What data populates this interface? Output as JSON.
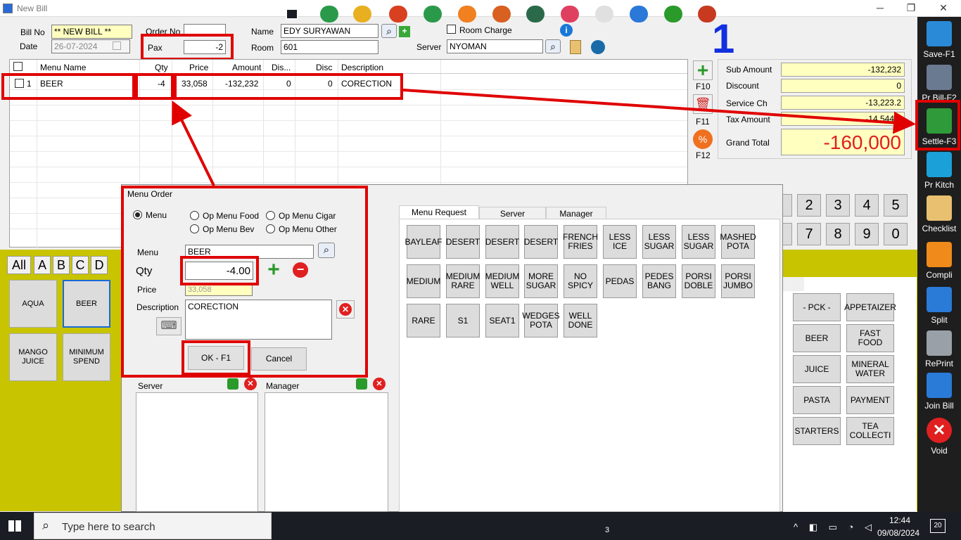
{
  "window": {
    "title": "New Bill",
    "min": "─",
    "restore": "❐",
    "close": "✕"
  },
  "header": {
    "bill_no_label": "Bill No",
    "bill_no": "** NEW BILL **",
    "date_label": "Date",
    "date": "26-07-2024",
    "order_no_label": "Order No",
    "order_no": "",
    "pax_label": "Pax",
    "pax": "-2",
    "name_label": "Name",
    "name": "EDY SURYAWAN",
    "room_label": "Room",
    "room": "601",
    "room_charge_label": "Room Charge",
    "server_label": "Server",
    "server": "NYOMAN",
    "table_number": "1"
  },
  "grid": {
    "columns": [
      "Menu Name",
      "Qty",
      "Price",
      "Amount",
      "Dis...",
      "Disc",
      "Description"
    ],
    "rows": [
      {
        "no": "1",
        "menu": "BEER",
        "qty": "-4",
        "price": "33,058",
        "amount": "-132,232",
        "dis": "0",
        "disc": "0",
        "description": "CORECTION"
      }
    ]
  },
  "fkeys": {
    "f10": "F10",
    "f11": "F11",
    "f12": "F12"
  },
  "summary": {
    "sub_amount_label": "Sub Amount",
    "sub_amount": "-132,232",
    "discount_label": "Discount",
    "discount": "0",
    "service_label": "Service Ch",
    "service": "-13,223.2",
    "tax_label": "Tax Amount",
    "tax": "-14,544.8",
    "grand_total_label": "Grand Total",
    "grand_total": "-160,000"
  },
  "numpad": [
    "2",
    "3",
    "4",
    "5",
    "7",
    "8",
    "9",
    "0"
  ],
  "sidebar": [
    {
      "label": "Save-F1",
      "icon": "floppy-icon",
      "color": "#2a8ad8"
    },
    {
      "label": "Pr Bill-F2",
      "icon": "printer-icon",
      "color": "#6a7a90"
    },
    {
      "label": "Settle-F3",
      "icon": "cash-register-icon",
      "color": "#2f9a3a"
    },
    {
      "label": "Pr Kitch",
      "icon": "kitchen-printer-icon",
      "color": "#1ba0d8"
    },
    {
      "label": "Checklist",
      "icon": "checklist-icon",
      "color": "#e8c070"
    },
    {
      "label": "Compli",
      "icon": "free-badge-icon",
      "color": "#f08a1a"
    },
    {
      "label": "Split",
      "icon": "split-shirt-icon",
      "color": "#2a7ad8"
    },
    {
      "label": "RePrint",
      "icon": "reprint-icon",
      "color": "#9aa0a8"
    },
    {
      "label": "Join Bill",
      "icon": "join-shirt-icon",
      "color": "#2a7ad8"
    },
    {
      "label": "Void",
      "icon": "void-x-icon",
      "color": "#e02020"
    }
  ],
  "categories": {
    "letters": [
      "All",
      "A",
      "B",
      "C",
      "D"
    ],
    "items": [
      "AQUA",
      "BEER",
      "MANGO JUICE",
      "MINIMUM SPEND"
    ],
    "groups": [
      "- PCK -",
      "APPETAIZER",
      "BEER",
      "FAST FOOD",
      "JUICE",
      "MINERAL WATER",
      "PASTA",
      "PAYMENT",
      "STARTERS",
      "TEA COLLECTI"
    ]
  },
  "dialog": {
    "title": "Menu Order",
    "radio_menu": "Menu",
    "radio_food": "Op Menu Food",
    "radio_cigar": "Op Menu Cigar",
    "radio_bev": "Op Menu Bev",
    "radio_other": "Op Menu Other",
    "menu_label": "Menu",
    "menu": "BEER",
    "qty_label": "Qty",
    "qty": "-4.00",
    "price_label": "Price",
    "price": "33,058",
    "description_label": "Description",
    "description": "CORECTION",
    "ok": "OK - F1",
    "cancel": "Cancel",
    "server_label": "Server",
    "manager_label": "Manager",
    "tabs": [
      "Menu Request",
      "Server",
      "Manager"
    ],
    "requests": [
      "BAYLEAF",
      "DESERT",
      "DESERT",
      "DESERT",
      "FRENCH FRIES",
      "LESS ICE",
      "LESS SUGAR",
      "LESS SUGAR",
      "MASHED POTA",
      "MEDIUM",
      "MEDIUM RARE",
      "MEDIUM WELL",
      "MORE SUGAR",
      "NO SPICY",
      "PEDAS",
      "PEDES BANG",
      "PORSI DOBLE",
      "PORSI JUMBO",
      "RARE",
      "S1",
      "SEAT1",
      "WEDGES POTA",
      "WELL DONE"
    ]
  },
  "taskbar": {
    "search_placeholder": "Type here to search",
    "time": "12:44",
    "date": "09/08/2024",
    "notif": "20",
    "badge": "3"
  }
}
